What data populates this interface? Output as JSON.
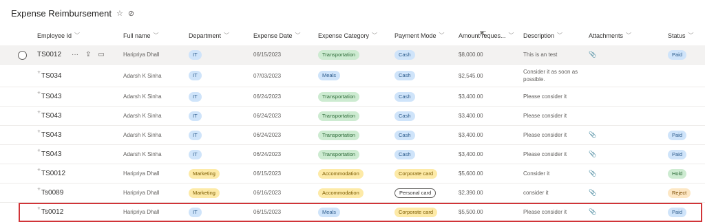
{
  "page": {
    "title": "Expense Reimbursement",
    "favorite_icon": "☆",
    "info_icon": "⊘"
  },
  "columns": [
    {
      "key": "id",
      "label": "Employee Id"
    },
    {
      "key": "name",
      "label": "Full name"
    },
    {
      "key": "dept",
      "label": "Department"
    },
    {
      "key": "date",
      "label": "Expense Date"
    },
    {
      "key": "cat",
      "label": "Expense Category"
    },
    {
      "key": "pay",
      "label": "Payment Mode"
    },
    {
      "key": "amt",
      "label": "Amount reques..."
    },
    {
      "key": "desc",
      "label": "Description"
    },
    {
      "key": "att",
      "label": "Attachments"
    },
    {
      "key": "status",
      "label": "Status"
    }
  ],
  "chevron": "﹀",
  "rows": [
    {
      "id": "TS0012",
      "name": "Haripriya Dhall",
      "dept": "IT",
      "date": "06/15/2023",
      "cat": "Transportation",
      "pay": "Cash",
      "amt": "$8,000.00",
      "desc": "This is an test",
      "att": true,
      "status": "Paid"
    },
    {
      "id": "TS034",
      "name": "Adarsh K Sinha",
      "dept": "IT",
      "date": "07/03/2023",
      "cat": "Meals",
      "pay": "Cash",
      "amt": "$2,545.00",
      "desc": "Consider it as soon as possible.",
      "att": false,
      "status": ""
    },
    {
      "id": "TS043",
      "name": "Adarsh K Sinha",
      "dept": "IT",
      "date": "06/24/2023",
      "cat": "Transportation",
      "pay": "Cash",
      "amt": "$3,400.00",
      "desc": "Please consider it",
      "att": false,
      "status": ""
    },
    {
      "id": "TS043",
      "name": "Adarsh K Sinha",
      "dept": "IT",
      "date": "06/24/2023",
      "cat": "Transportation",
      "pay": "Cash",
      "amt": "$3,400.00",
      "desc": "Please consider it",
      "att": false,
      "status": ""
    },
    {
      "id": "TS043",
      "name": "Adarsh K Sinha",
      "dept": "IT",
      "date": "06/24/2023",
      "cat": "Transportation",
      "pay": "Cash",
      "amt": "$3,400.00",
      "desc": "Please consider it",
      "att": true,
      "status": "Paid"
    },
    {
      "id": "TS043",
      "name": "Adarsh K Sinha",
      "dept": "IT",
      "date": "06/24/2023",
      "cat": "Transportation",
      "pay": "Cash",
      "amt": "$3,400.00",
      "desc": "Please consider it",
      "att": true,
      "status": "Paid"
    },
    {
      "id": "TS0012",
      "name": "Haripriya Dhall",
      "dept": "Marketing",
      "date": "06/15/2023",
      "cat": "Accommodation",
      "pay": "Corporate card",
      "amt": "$5,600.00",
      "desc": "Consider it",
      "att": true,
      "status": "Hold"
    },
    {
      "id": "Ts0089",
      "name": "Haripriya Dhall",
      "dept": "Marketing",
      "date": "06/16/2023",
      "cat": "Accommodation",
      "pay": "Personal card",
      "amt": "$2,390.00",
      "desc": "consider it",
      "att": true,
      "status": "Reject"
    },
    {
      "id": "Ts0012",
      "name": "Haripriya Dhall",
      "dept": "IT",
      "date": "06/15/2023",
      "cat": "Meals",
      "pay": "Corporate card",
      "amt": "$5,500.00",
      "desc": "Please consider it",
      "att": true,
      "status": "Paid"
    }
  ],
  "pill_colors": {
    "IT": "blue",
    "Marketing": "yellow",
    "Transportation": "green",
    "Meals": "blue",
    "Accommodation": "yellow",
    "Cash": "blue",
    "Corporate card": "yellow",
    "Personal card": "outline",
    "Paid": "blue",
    "Hold": "green",
    "Reject": "peach"
  },
  "icons": {
    "attachment": "📎",
    "more": "···",
    "share": "⇪",
    "comment": "▭",
    "new": "✳"
  }
}
